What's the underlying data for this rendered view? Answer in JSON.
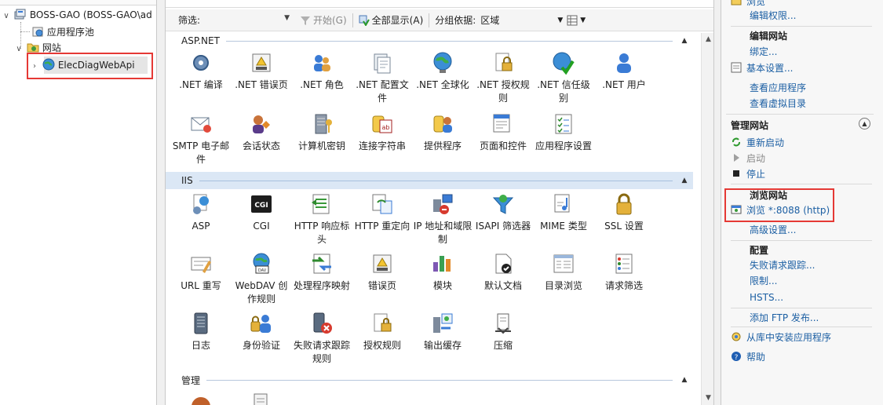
{
  "tree": {
    "server_label": "BOSS-GAO (BOSS-GAO\\ad",
    "app_pools_label": "应用程序池",
    "sites_label": "网站",
    "site_label": "ElecDiagWebApi"
  },
  "filter_bar": {
    "filter_label": "筛选:",
    "start_label": "开始(G)",
    "show_all_label": "全部显示(A)",
    "group_by_label": "分组依据:",
    "group_by_value": "区域"
  },
  "sections": {
    "aspnet": {
      "title": "ASP.NET",
      "items": [
        ".NET 编译",
        ".NET 错误页",
        ".NET 角色",
        ".NET 配置文件",
        ".NET 全球化",
        ".NET 授权规则",
        ".NET 信任级别",
        ".NET 用户",
        "SMTP 电子邮件",
        "会话状态",
        "计算机密钥",
        "连接字符串",
        "提供程序",
        "页面和控件",
        "应用程序设置"
      ]
    },
    "iis": {
      "title": "IIS",
      "items": [
        "ASP",
        "CGI",
        "HTTP 响应标头",
        "HTTP 重定向",
        "IP 地址和域限制",
        "ISAPI 筛选器",
        "MIME 类型",
        "SSL 设置",
        "URL 重写",
        "WebDAV 创作规则",
        "处理程序映射",
        "错误页",
        "模块",
        "默认文档",
        "目录浏览",
        "请求筛选",
        "日志",
        "身份验证",
        "失败请求跟踪规则",
        "授权规则",
        "输出缓存",
        "压缩"
      ]
    },
    "manage": {
      "title": "管理"
    }
  },
  "actions": {
    "browse_top": "浏览",
    "edit_permissions": "编辑权限...",
    "edit_site_header": "编辑网站",
    "bindings": "绑定...",
    "basic_settings": "基本设置...",
    "view_applications": "查看应用程序",
    "view_virtual_dirs": "查看虚拟目录",
    "manage_site_header": "管理网站",
    "restart": "重新启动",
    "start": "启动",
    "stop": "停止",
    "browse_site_header": "浏览网站",
    "browse_8088": "浏览 *:8088 (http)",
    "advanced_settings": "高级设置...",
    "config_header": "配置",
    "failed_request_tracing": "失败请求跟踪...",
    "limits": "限制...",
    "hsts": "HSTS...",
    "add_ftp": "添加 FTP 发布...",
    "install_from_gallery": "从库中安装应用程序",
    "help": "帮助"
  },
  "colors": {
    "link": "#1c5fa3",
    "highlight_border": "#e53935",
    "iis_header_bg": "#dbe7f5"
  }
}
